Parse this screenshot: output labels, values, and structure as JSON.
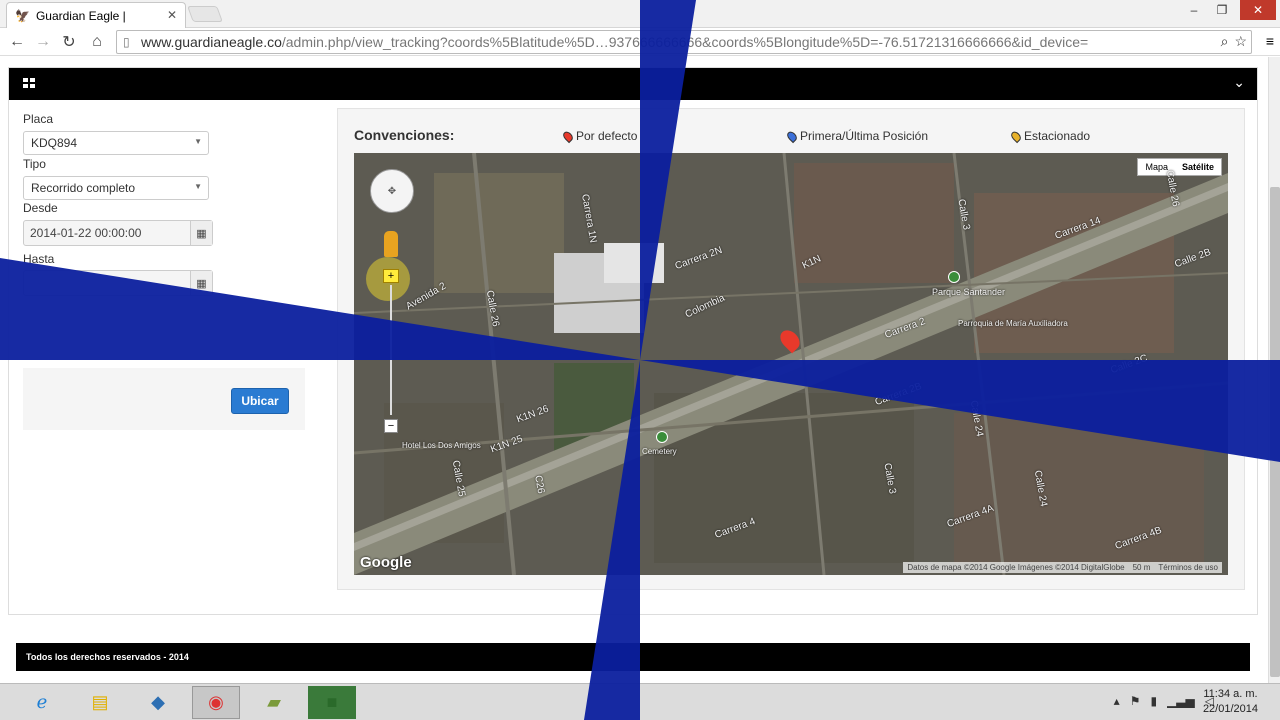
{
  "browser": {
    "tab_title": "Guardian Eagle |",
    "tab_close": "✕",
    "url_domain": "www.guardianeagle.co",
    "url_path": "/admin.php/view_tracking?coords%5Blatitude%5D…937666666666&coords%5Blongitude%5D=-76.51721316666666&id_device=",
    "win_minimize": "–",
    "win_restore": "❐",
    "win_close": "✕"
  },
  "form": {
    "placa_label": "Placa",
    "placa_value": "KDQ894",
    "tipo_label": "Tipo",
    "tipo_value": "Recorrido completo",
    "desde_label": "Desde",
    "desde_value": "2014-01-22 00:00:00",
    "hasta_label": "Hasta",
    "hasta_value": "",
    "ubicar_label": "Ubicar"
  },
  "legend": {
    "title": "Convenciones:",
    "items": [
      {
        "label": "Por defecto",
        "color": "#e8392b"
      },
      {
        "label": "Primera/Última Posición",
        "color": "#3b6fd8"
      },
      {
        "label": "Estacionado",
        "color": "#e8b22b"
      }
    ]
  },
  "map": {
    "type_map": "Mapa",
    "type_satellite": "Satélite",
    "selected_type": "Satélite",
    "google": "Google",
    "attribution": "Datos de mapa ©2014 Google Imágenes ©2014 DigitalGlobe",
    "scale": "50 m",
    "terms": "Términos de uso",
    "labels": [
      "Colombia",
      "K1N",
      "K1N 26",
      "K1N 25",
      "Carrera 2",
      "Carrera 4",
      "Carrera 4A",
      "Calle 25",
      "Calle 26",
      "Calle 24",
      "Calle 3",
      "Calle 2B",
      "Parque Santander",
      "Parroquia de María Auxiliadora",
      "Hotel Los Dos Amigos",
      "Cemetery",
      "Avenida 2",
      "Carrera 1N",
      "Calle 2C",
      "Carrera 2N",
      "C26",
      "Carrera 14",
      "Carrera 2B",
      "Carrera 4B",
      "Calle 3",
      "Calle 24",
      "Calle 26"
    ]
  },
  "footer": {
    "text": "Todos los derechos reservados - 2014"
  },
  "taskbar": {
    "time": "11:34 a. m.",
    "date": "22/01/2014"
  }
}
